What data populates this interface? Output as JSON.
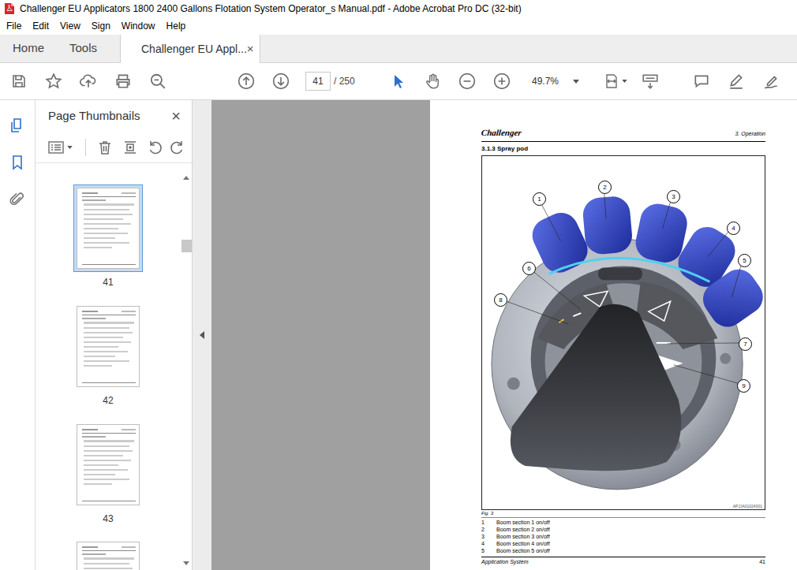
{
  "window": {
    "title": "Challenger EU Applicators 1800 2400 Gallons Flotation System Operator_s Manual.pdf - Adobe Acrobat Pro DC (32-bit)"
  },
  "menu": [
    "File",
    "Edit",
    "View",
    "Sign",
    "Window",
    "Help"
  ],
  "tabs": [
    {
      "label": "Home",
      "selected": false
    },
    {
      "label": "Tools",
      "selected": false
    },
    {
      "label": "Challenger EU Appl...",
      "selected": true,
      "close": "×"
    }
  ],
  "toolbar": {
    "page": "41",
    "page_total": "/ 250",
    "zoom": "49.7%"
  },
  "thumbnails": {
    "title": "Page Thumbnails",
    "close": "×",
    "pages": [
      {
        "label": "41",
        "selected": true
      },
      {
        "label": "42",
        "selected": false
      },
      {
        "label": "43",
        "selected": false
      }
    ]
  },
  "document": {
    "brand": "Challenger",
    "chapter": "3. Operation",
    "section": "3.1.3 Spray pod",
    "figure": {
      "callouts": [
        "1",
        "2",
        "3",
        "4",
        "5",
        "6",
        "7",
        "8",
        "9"
      ],
      "code": "APJJA01024001",
      "caption": "Fig. 3"
    },
    "legend": [
      {
        "number": "1",
        "text": "Boom section 1 on/off"
      },
      {
        "number": "2",
        "text": "Boom section 2 on/off"
      },
      {
        "number": "3",
        "text": "Boom section 3 on/off"
      },
      {
        "number": "4",
        "text": "Boom section 4 on/off"
      },
      {
        "number": "5",
        "text": "Boom section 5 on/off"
      }
    ],
    "footer": {
      "title": "Application System",
      "page": "41"
    }
  }
}
